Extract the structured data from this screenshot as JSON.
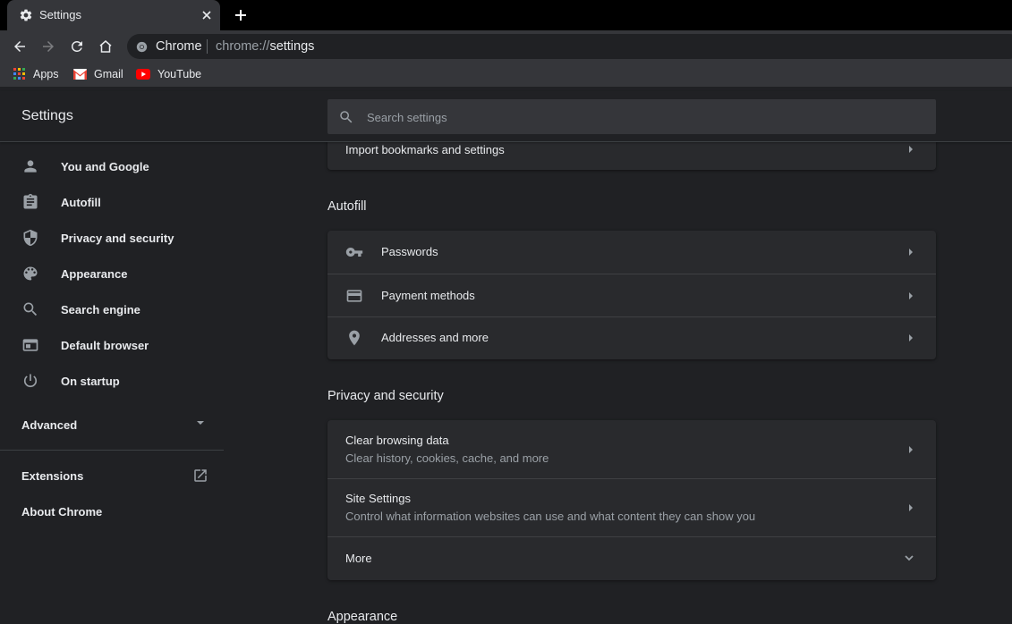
{
  "tab": {
    "title": "Settings"
  },
  "omnibox": {
    "site_name": "Chrome",
    "url_scheme": "chrome://",
    "url_path": "settings"
  },
  "bookmarks": [
    {
      "label": "Apps",
      "icon": "apps-grid-icon"
    },
    {
      "label": "Gmail",
      "icon": "gmail-icon"
    },
    {
      "label": "YouTube",
      "icon": "youtube-icon"
    }
  ],
  "header": {
    "title": "Settings",
    "search_placeholder": "Search settings"
  },
  "sidebar": {
    "items": [
      {
        "label": "You and Google",
        "icon": "person-icon"
      },
      {
        "label": "Autofill",
        "icon": "clipboard-icon"
      },
      {
        "label": "Privacy and security",
        "icon": "shield-icon"
      },
      {
        "label": "Appearance",
        "icon": "palette-icon"
      },
      {
        "label": "Search engine",
        "icon": "search-icon"
      },
      {
        "label": "Default browser",
        "icon": "browser-window-icon"
      },
      {
        "label": "On startup",
        "icon": "power-icon"
      }
    ],
    "advanced": "Advanced",
    "extensions": "Extensions",
    "about": "About Chrome"
  },
  "main": {
    "import_row": "Import bookmarks and settings",
    "autofill": {
      "title": "Autofill",
      "rows": [
        {
          "label": "Passwords",
          "icon": "key-icon"
        },
        {
          "label": "Payment methods",
          "icon": "credit-card-icon"
        },
        {
          "label": "Addresses and more",
          "icon": "location-pin-icon"
        }
      ]
    },
    "privacy": {
      "title": "Privacy and security",
      "rows": [
        {
          "label": "Clear browsing data",
          "sub": "Clear history, cookies, cache, and more"
        },
        {
          "label": "Site Settings",
          "sub": "Control what information websites can use and what content they can show you"
        }
      ],
      "more": "More"
    },
    "appearance_title": "Appearance"
  },
  "colors": {
    "background": "#202124",
    "card": "#292a2d",
    "toolbar": "#35363a",
    "text": "#e8eaed",
    "secondary_text": "#9aa0a6"
  }
}
